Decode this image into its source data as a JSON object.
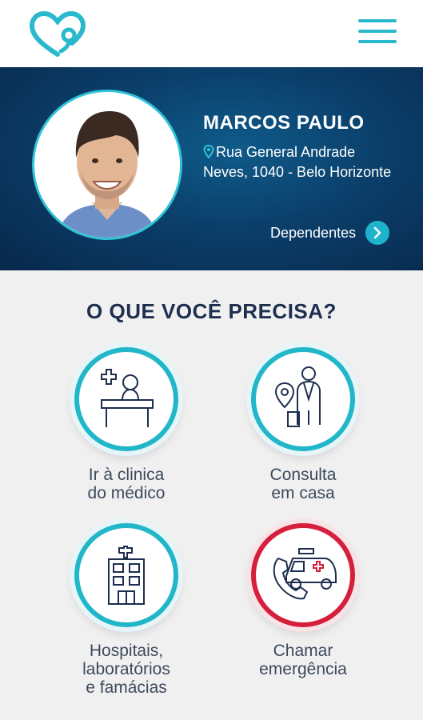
{
  "header": {
    "logo_icon": "heart-stethoscope-icon",
    "menu_icon": "hamburger-menu-icon",
    "accent_color": "#29b8cc"
  },
  "profile": {
    "name": "MARCOS PAULO",
    "address": "Rua General Andrade Neves, 1040 - Belo Horizonte",
    "dependents_label": "Dependentes",
    "background_color": "#0b3f6b"
  },
  "main": {
    "title": "O QUE VOCÊ PRECISA?",
    "services": [
      {
        "label_line1": "Ir à clinica",
        "label_line2": "do médico",
        "label_line3": "",
        "icon": "receptionist-desk-icon",
        "ring_color": "#22b6c9"
      },
      {
        "label_line1": "Consulta",
        "label_line2": "em casa",
        "label_line3": "",
        "icon": "doctor-house-call-icon",
        "ring_color": "#22b6c9"
      },
      {
        "label_line1": "Hospitais,",
        "label_line2": "laboratórios",
        "label_line3": "e famácias",
        "icon": "hospital-building-icon",
        "ring_color": "#22b6c9"
      },
      {
        "label_line1": "Chamar",
        "label_line2": "emergência",
        "label_line3": "",
        "icon": "ambulance-phone-icon",
        "ring_color": "#d61f3c"
      }
    ]
  }
}
